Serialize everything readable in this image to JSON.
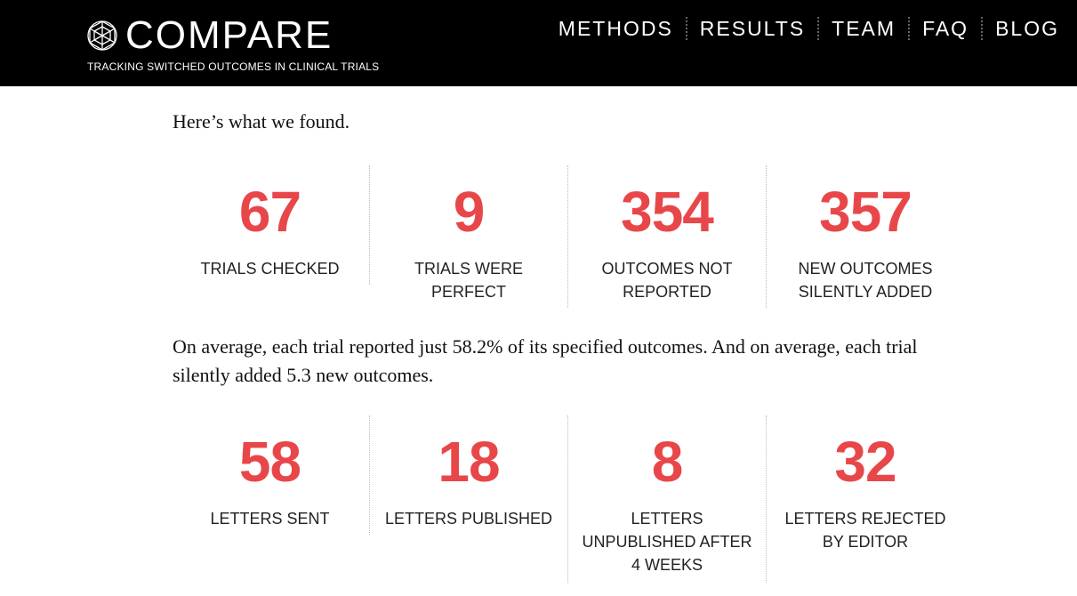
{
  "header": {
    "logo_text": "COMPARE",
    "tagline": "TRACKING SWITCHED OUTCOMES IN CLINICAL TRIALS",
    "nav": [
      "METHODS",
      "RESULTS",
      "TEAM",
      "FAQ",
      "BLOG"
    ]
  },
  "intro": "Here’s what we found.",
  "stats_row1": [
    {
      "value": "67",
      "label": "TRIALS CHECKED"
    },
    {
      "value": "9",
      "label": "TRIALS WERE PERFECT"
    },
    {
      "value": "354",
      "label": "OUTCOMES NOT REPORTED"
    },
    {
      "value": "357",
      "label": "NEW OUTCOMES SILENTLY ADDED"
    }
  ],
  "paragraph": "On average, each trial reported just 58.2% of its specified outcomes. And on average, each trial silently added 5.3 new outcomes.",
  "stats_row2": [
    {
      "value": "58",
      "label": "LETTERS SENT"
    },
    {
      "value": "18",
      "label": "LETTERS PUBLISHED"
    },
    {
      "value": "8",
      "label": "LETTERS UNPUBLISHED AFTER 4 WEEKS"
    },
    {
      "value": "32",
      "label": "LETTERS REJECTED BY EDITOR"
    }
  ],
  "colors": {
    "accent": "#e8474a",
    "header_bg": "#000000"
  },
  "icons": {
    "logo": "geodesic-sphere-icon"
  }
}
